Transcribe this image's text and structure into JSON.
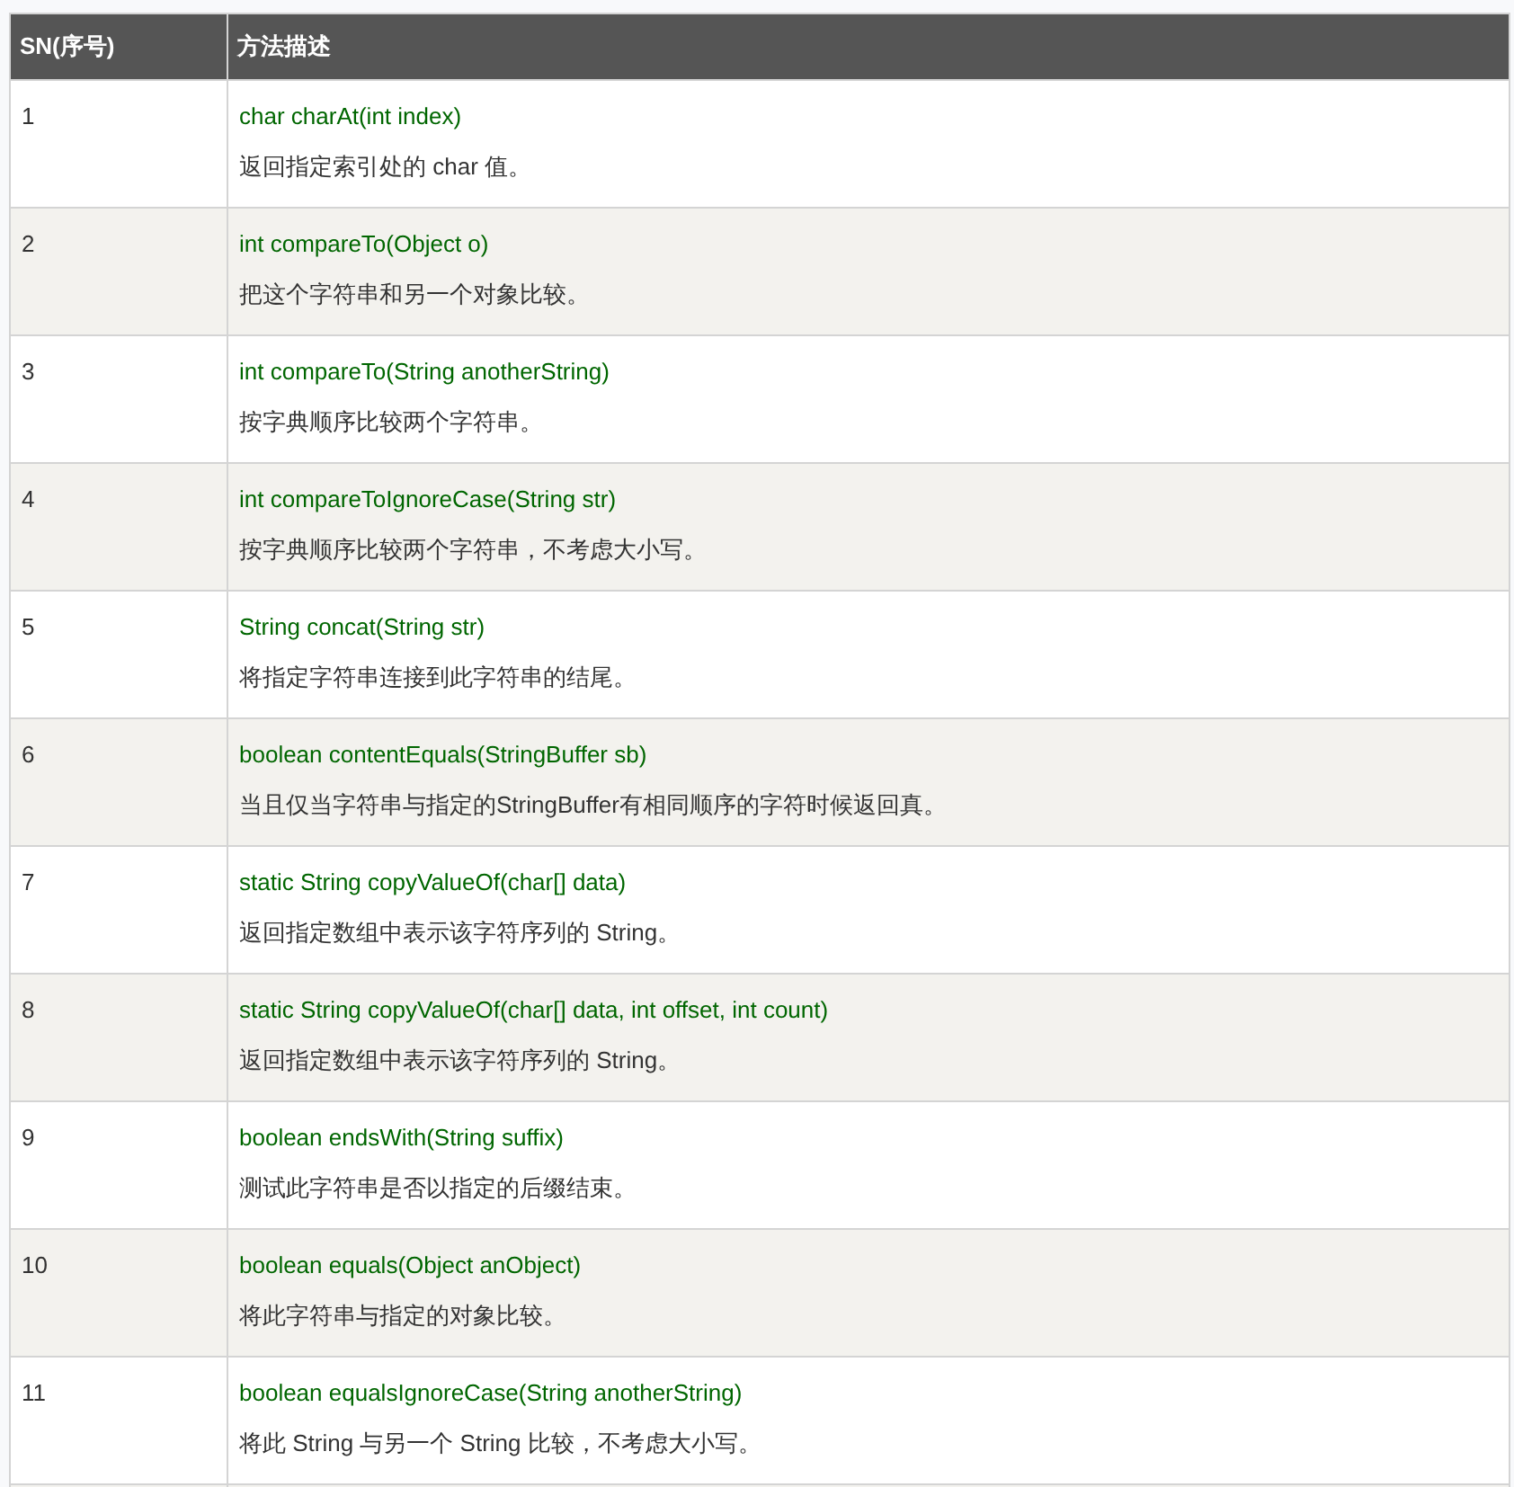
{
  "table": {
    "columns": [
      "SN(序号)",
      "方法描述"
    ],
    "rows": [
      {
        "sn": "1",
        "method": "char charAt(int index)",
        "description": "返回指定索引处的 char 值。"
      },
      {
        "sn": "2",
        "method": "int compareTo(Object o)",
        "description": "把这个字符串和另一个对象比较。"
      },
      {
        "sn": "3",
        "method": "int compareTo(String anotherString)",
        "description": "按字典顺序比较两个字符串。"
      },
      {
        "sn": "4",
        "method": "int compareToIgnoreCase(String str)",
        "description": "按字典顺序比较两个字符串，不考虑大小写。"
      },
      {
        "sn": "5",
        "method": "String concat(String str)",
        "description": "将指定字符串连接到此字符串的结尾。"
      },
      {
        "sn": "6",
        "method": "boolean contentEquals(StringBuffer sb)",
        "description": "当且仅当字符串与指定的StringBuffer有相同顺序的字符时候返回真。"
      },
      {
        "sn": "7",
        "method": "static String copyValueOf(char[] data)",
        "description": "返回指定数组中表示该字符序列的 String。"
      },
      {
        "sn": "8",
        "method": "static String copyValueOf(char[] data, int offset, int count)",
        "description": "返回指定数组中表示该字符序列的 String。"
      },
      {
        "sn": "9",
        "method": "boolean endsWith(String suffix)",
        "description": "测试此字符串是否以指定的后缀结束。"
      },
      {
        "sn": "10",
        "method": "boolean equals(Object anObject)",
        "description": "将此字符串与指定的对象比较。"
      },
      {
        "sn": "11",
        "method": "boolean equalsIgnoreCase(String anotherString)",
        "description": "将此 String 与另一个 String 比较，不考虑大小写。"
      }
    ]
  }
}
